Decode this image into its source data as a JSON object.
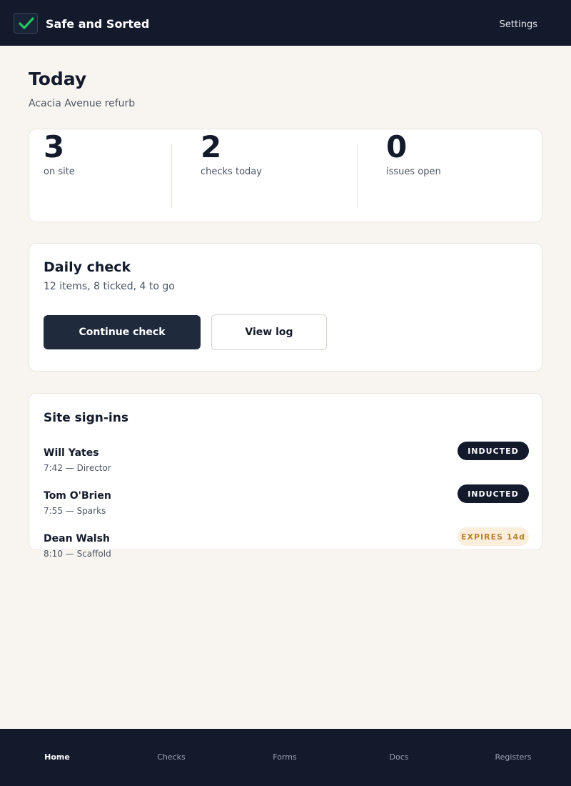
{
  "header": {
    "app_title": "Safe and Sorted",
    "settings_label": "Settings",
    "logo_icon": "check-icon",
    "accent_color": "#22c55e"
  },
  "page": {
    "title": "Today",
    "subtitle": "Acacia Avenue refurb"
  },
  "stats": [
    {
      "value": "3",
      "label": "on site"
    },
    {
      "value": "2",
      "label": "checks today"
    },
    {
      "value": "0",
      "label": "issues open"
    }
  ],
  "daily_check": {
    "title": "Daily check",
    "summary": "12 items, 8 ticked, 4 to go",
    "continue_label": "Continue check",
    "view_log_label": "View log"
  },
  "signins": {
    "title": "Site sign-ins",
    "rows": [
      {
        "name": "Will Yates",
        "meta": "7:42 — Director",
        "badge": "INDUCTED",
        "badge_type": "inducted"
      },
      {
        "name": "Tom O'Brien",
        "meta": "7:55 — Sparks",
        "badge": "INDUCTED",
        "badge_type": "inducted"
      },
      {
        "name": "Dean Walsh",
        "meta": "8:10 — Scaffold",
        "badge": "EXPIRES 14d",
        "badge_type": "expires"
      }
    ]
  },
  "nav": {
    "items": [
      "Home",
      "Checks",
      "Forms",
      "Docs",
      "Registers"
    ],
    "active": "Home"
  }
}
